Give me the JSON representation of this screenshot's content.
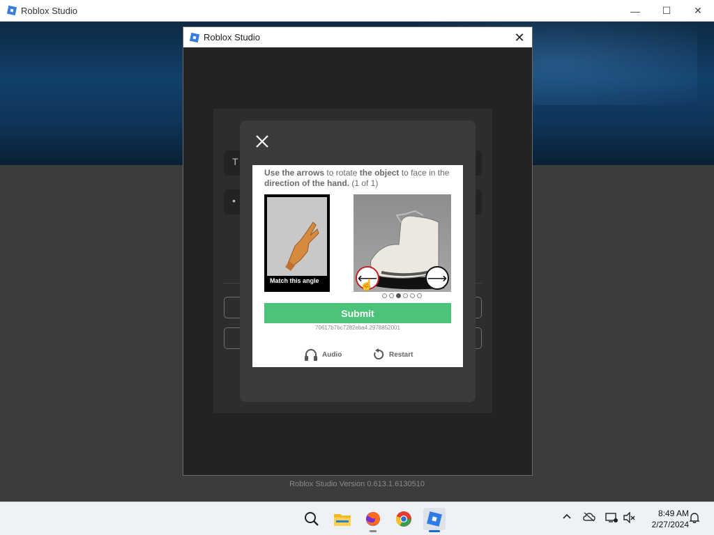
{
  "outer_window": {
    "title": "Roblox Studio",
    "minimize": "—",
    "maximize": "☐",
    "close": "✕"
  },
  "inner_window": {
    "title": "Roblox Studio",
    "close": "✕"
  },
  "login_form": {
    "field1_text": "T",
    "field2_text": "•"
  },
  "captcha": {
    "instructions_part1": "Use the arrows",
    "instructions_part2": " to rotate ",
    "instructions_part3": "the object",
    "instructions_part4": " to face in the ",
    "instructions_part5": "direction of the hand.",
    "instructions_part6": " (1 of 1)",
    "hand_label": "Match this angle",
    "left_arrow": "⟵",
    "right_arrow": "⟶",
    "dots_total": 6,
    "active_dot": 3,
    "submit_label": "Submit",
    "session_id": "70617b7bc7282eba4.2978852001",
    "audio_label": "Audio",
    "restart_label": "Restart"
  },
  "version_text": "Roblox Studio Version 0.613.1.6130510",
  "taskbar": {
    "time": "8:49 AM",
    "date": "2/27/2024"
  },
  "colors": {
    "submit_green": "#4bc47a",
    "overlay_dark": "#393b3d",
    "roblox_blue": "#1b67d6"
  }
}
